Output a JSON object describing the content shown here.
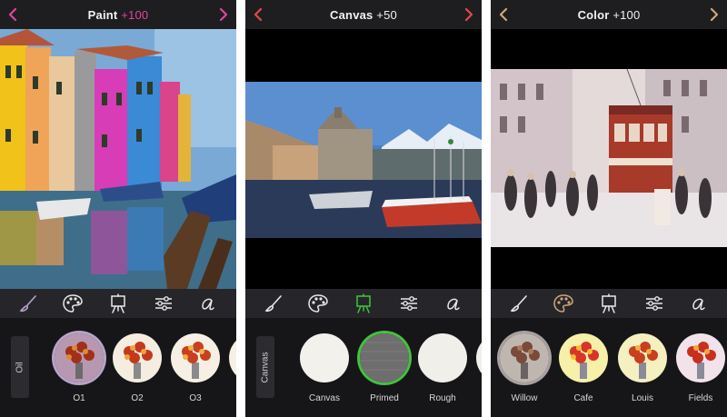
{
  "colors": {
    "accent_paint": "#e0449d",
    "accent_canvas": "#e04a4a",
    "accent_color": "#cfa57a",
    "selected_green": "#43c23e",
    "selected_purple": "#b7a3c9",
    "bar_bg": "#1e1e20",
    "panel_bg": "#161618"
  },
  "screens": [
    {
      "title_name": "Paint",
      "title_amount": "+100",
      "left_arrow": "chevron-left-icon",
      "right_arrow": "chevron-right-icon",
      "image": "painted-venice-canal-houses",
      "side_tab": "Oil",
      "tools": [
        "brush-icon",
        "palette-icon",
        "canvas-easel-icon",
        "sliders-icon",
        "script-a-icon"
      ],
      "active_tool": "brush-icon",
      "options": [
        {
          "label": "O1",
          "selected": true
        },
        {
          "label": "O2",
          "selected": false
        },
        {
          "label": "O3",
          "selected": false
        }
      ]
    },
    {
      "title_name": "Canvas",
      "title_amount": "+50",
      "left_arrow": "chevron-left-icon",
      "right_arrow": "chevron-right-icon",
      "image": "painted-lakeside-harbor",
      "side_tab": "Canvas",
      "tools": [
        "brush-icon",
        "palette-icon",
        "canvas-easel-icon",
        "sliders-icon",
        "script-a-icon"
      ],
      "active_tool": "canvas-easel-icon",
      "options": [
        {
          "label": "Canvas",
          "selected": false
        },
        {
          "label": "Primed",
          "selected": true
        },
        {
          "label": "Rough",
          "selected": false
        }
      ]
    },
    {
      "title_name": "Color",
      "title_amount": "+100",
      "left_arrow": "chevron-left-icon",
      "right_arrow": "chevron-right-icon",
      "image": "sketched-street-with-tram",
      "tools": [
        "brush-icon",
        "palette-icon",
        "canvas-easel-icon",
        "sliders-icon",
        "script-a-icon"
      ],
      "active_tool": "palette-icon",
      "options": [
        {
          "label": "Willow",
          "selected": true
        },
        {
          "label": "Cafe",
          "selected": false
        },
        {
          "label": "Louis",
          "selected": false
        },
        {
          "label": "Fields",
          "selected": false
        }
      ]
    }
  ]
}
